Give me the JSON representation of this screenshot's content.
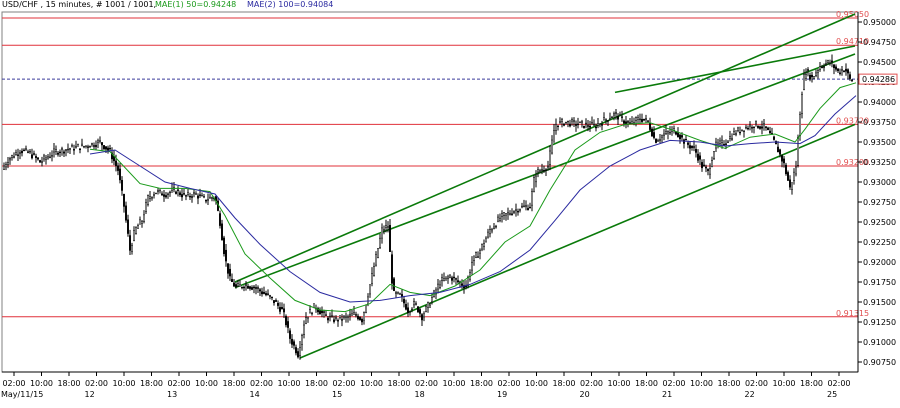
{
  "header": {
    "symbol_line": "USD/CHF , 15 minutes, # 1001 / 1001,",
    "mae1_label": "MAE(1) 50=0.94248",
    "mae2_label": "MAE(2) 100=0.94084"
  },
  "colors": {
    "background": "#ffffff",
    "candle": "#000000",
    "horizontal_level": "#e0303a",
    "channel_line": "#0a7a0a",
    "mae1": "#1a9a1a",
    "mae2": "#2a2aa0",
    "current_price_line": "#3a3a9a",
    "axis": "#000000",
    "level_label_text": "#e05050",
    "header_text": "#000000"
  },
  "chart_data": {
    "type": "candlestick",
    "title": "",
    "xlabel": "",
    "ylabel": "",
    "ylim": [
      0.90625,
      0.95125
    ],
    "y_ticks": [
      "0.95000",
      "0.94750",
      "0.94500",
      "0.94250",
      "0.94000",
      "0.93750",
      "0.93500",
      "0.93250",
      "0.93000",
      "0.92750",
      "0.92500",
      "0.92250",
      "0.92000",
      "0.91750",
      "0.91500",
      "0.91250",
      "0.91000",
      "0.90750"
    ],
    "x_ticks": [
      "02:00",
      "10:00",
      "18:00",
      "02:00",
      "10:00",
      "18:00",
      "02:00",
      "10:00",
      "18:00",
      "02:00",
      "10:00",
      "18:00",
      "02:00",
      "10:00",
      "18:00",
      "02:00",
      "10:00",
      "18:00",
      "02:00",
      "10:00",
      "18:00",
      "02:00",
      "10:00",
      "18:00",
      "02:00",
      "10:00",
      "18:00",
      "02:00",
      "10:00",
      "18:00",
      "02:00"
    ],
    "date_labels": [
      {
        "label": "May/11/15",
        "at_tick": 0
      },
      {
        "label": "12",
        "at_tick": 3
      },
      {
        "label": "13",
        "at_tick": 6
      },
      {
        "label": "14",
        "at_tick": 9
      },
      {
        "label": "15",
        "at_tick": 12
      },
      {
        "label": "18",
        "at_tick": 15
      },
      {
        "label": "19",
        "at_tick": 18
      },
      {
        "label": "20",
        "at_tick": 21
      },
      {
        "label": "21",
        "at_tick": 24
      },
      {
        "label": "22",
        "at_tick": 27
      },
      {
        "label": "25",
        "at_tick": 30
      }
    ],
    "horizontal_levels": [
      {
        "label": "0.95050",
        "value": 0.9505
      },
      {
        "label": "0.94710",
        "value": 0.9471
      },
      {
        "label": "0.93720",
        "value": 0.9372
      },
      {
        "label": "0.93200",
        "value": 0.932
      },
      {
        "label": "0.91315",
        "value": 0.91315
      }
    ],
    "current_price": {
      "label": "0.94286",
      "value": 0.94286
    },
    "price_path": [
      [
        0,
        0.9312
      ],
      [
        8,
        0.9328
      ],
      [
        20,
        0.934
      ],
      [
        30,
        0.9336
      ],
      [
        40,
        0.9325
      ],
      [
        55,
        0.9338
      ],
      [
        70,
        0.9342
      ],
      [
        85,
        0.9345
      ],
      [
        100,
        0.935
      ],
      [
        110,
        0.9338
      ],
      [
        118,
        0.9315
      ],
      [
        124,
        0.927
      ],
      [
        130,
        0.9215
      ],
      [
        135,
        0.924
      ],
      [
        142,
        0.9252
      ],
      [
        148,
        0.928
      ],
      [
        155,
        0.9288
      ],
      [
        165,
        0.9285
      ],
      [
        175,
        0.929
      ],
      [
        185,
        0.9282
      ],
      [
        195,
        0.9285
      ],
      [
        205,
        0.9278
      ],
      [
        215,
        0.9282
      ],
      [
        220,
        0.925
      ],
      [
        225,
        0.9205
      ],
      [
        230,
        0.9178
      ],
      [
        236,
        0.9168
      ],
      [
        245,
        0.9172
      ],
      [
        255,
        0.9168
      ],
      [
        265,
        0.916
      ],
      [
        275,
        0.915
      ],
      [
        283,
        0.9138
      ],
      [
        290,
        0.9105
      ],
      [
        298,
        0.9085
      ],
      [
        305,
        0.913
      ],
      [
        315,
        0.9145
      ],
      [
        325,
        0.9132
      ],
      [
        335,
        0.9128
      ],
      [
        345,
        0.913
      ],
      [
        355,
        0.9135
      ],
      [
        362,
        0.9128
      ],
      [
        368,
        0.916
      ],
      [
        375,
        0.92
      ],
      [
        382,
        0.924
      ],
      [
        388,
        0.9245
      ],
      [
        393,
        0.916
      ],
      [
        400,
        0.9158
      ],
      [
        408,
        0.914
      ],
      [
        415,
        0.9148
      ],
      [
        422,
        0.9132
      ],
      [
        430,
        0.915
      ],
      [
        440,
        0.9175
      ],
      [
        450,
        0.9182
      ],
      [
        458,
        0.9175
      ],
      [
        466,
        0.917
      ],
      [
        472,
        0.92
      ],
      [
        480,
        0.9215
      ],
      [
        490,
        0.924
      ],
      [
        500,
        0.9255
      ],
      [
        510,
        0.9262
      ],
      [
        520,
        0.9268
      ],
      [
        530,
        0.927
      ],
      [
        535,
        0.931
      ],
      [
        540,
        0.9315
      ],
      [
        548,
        0.932
      ],
      [
        555,
        0.9372
      ],
      [
        565,
        0.9375
      ],
      [
        580,
        0.9372
      ],
      [
        595,
        0.937
      ],
      [
        605,
        0.9378
      ],
      [
        615,
        0.9385
      ],
      [
        622,
        0.9378
      ],
      [
        630,
        0.9372
      ],
      [
        640,
        0.938
      ],
      [
        648,
        0.9375
      ],
      [
        655,
        0.9352
      ],
      [
        665,
        0.936
      ],
      [
        675,
        0.9365
      ],
      [
        685,
        0.935
      ],
      [
        695,
        0.934
      ],
      [
        702,
        0.932
      ],
      [
        708,
        0.9312
      ],
      [
        715,
        0.9345
      ],
      [
        725,
        0.935
      ],
      [
        735,
        0.9362
      ],
      [
        745,
        0.9368
      ],
      [
        755,
        0.9372
      ],
      [
        765,
        0.9368
      ],
      [
        772,
        0.9355
      ],
      [
        778,
        0.934
      ],
      [
        784,
        0.9322
      ],
      [
        790,
        0.9292
      ],
      [
        796,
        0.932
      ],
      [
        801,
        0.9405
      ],
      [
        805,
        0.944
      ],
      [
        812,
        0.943
      ],
      [
        820,
        0.9445
      ],
      [
        830,
        0.945
      ],
      [
        838,
        0.9438
      ],
      [
        845,
        0.9442
      ],
      [
        850,
        0.9428
      ]
    ],
    "mae1_path": [
      [
        90,
        0.9341
      ],
      [
        110,
        0.9338
      ],
      [
        125,
        0.9318
      ],
      [
        140,
        0.9298
      ],
      [
        160,
        0.9292
      ],
      [
        185,
        0.9292
      ],
      [
        210,
        0.9288
      ],
      [
        225,
        0.9258
      ],
      [
        245,
        0.921
      ],
      [
        270,
        0.918
      ],
      [
        295,
        0.9152
      ],
      [
        320,
        0.914
      ],
      [
        345,
        0.9138
      ],
      [
        370,
        0.9148
      ],
      [
        390,
        0.9172
      ],
      [
        410,
        0.9162
      ],
      [
        430,
        0.9158
      ],
      [
        455,
        0.917
      ],
      [
        480,
        0.919
      ],
      [
        505,
        0.9225
      ],
      [
        530,
        0.9245
      ],
      [
        550,
        0.929
      ],
      [
        575,
        0.934
      ],
      [
        600,
        0.9362
      ],
      [
        625,
        0.9372
      ],
      [
        650,
        0.9374
      ],
      [
        670,
        0.9366
      ],
      [
        700,
        0.9352
      ],
      [
        725,
        0.9342
      ],
      [
        750,
        0.9356
      ],
      [
        775,
        0.936
      ],
      [
        795,
        0.935
      ],
      [
        805,
        0.9366
      ],
      [
        820,
        0.9392
      ],
      [
        840,
        0.9418
      ],
      [
        856,
        0.9424
      ]
    ],
    "mae2_path": [
      [
        90,
        0.9335
      ],
      [
        115,
        0.934
      ],
      [
        140,
        0.932
      ],
      [
        165,
        0.93
      ],
      [
        190,
        0.9292
      ],
      [
        215,
        0.9285
      ],
      [
        235,
        0.9255
      ],
      [
        260,
        0.9222
      ],
      [
        290,
        0.9188
      ],
      [
        320,
        0.9162
      ],
      [
        350,
        0.915
      ],
      [
        380,
        0.9152
      ],
      [
        410,
        0.9158
      ],
      [
        440,
        0.9162
      ],
      [
        470,
        0.9172
      ],
      [
        500,
        0.9188
      ],
      [
        530,
        0.9215
      ],
      [
        555,
        0.9252
      ],
      [
        580,
        0.929
      ],
      [
        610,
        0.932
      ],
      [
        640,
        0.934
      ],
      [
        670,
        0.9352
      ],
      [
        700,
        0.935
      ],
      [
        725,
        0.9345
      ],
      [
        750,
        0.9348
      ],
      [
        775,
        0.935
      ],
      [
        800,
        0.9348
      ],
      [
        815,
        0.9358
      ],
      [
        835,
        0.9385
      ],
      [
        856,
        0.9408
      ]
    ],
    "channel_lines": [
      [
        [
          235,
          0.9175
        ],
        [
          855,
          0.951
        ]
      ],
      [
        [
          300,
          0.908
        ],
        [
          855,
          0.9372
        ]
      ],
      [
        [
          615,
          0.9412
        ],
        [
          855,
          0.947
        ]
      ],
      [
        [
          235,
          0.9168
        ],
        [
          855,
          0.946
        ]
      ]
    ]
  }
}
